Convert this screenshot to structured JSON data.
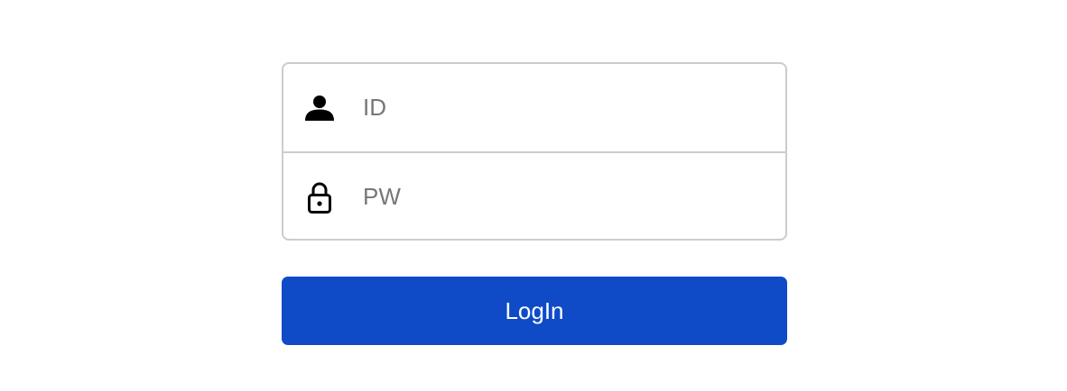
{
  "login_form": {
    "id_field": {
      "icon": "user-icon",
      "placeholder": "ID",
      "value": ""
    },
    "pw_field": {
      "icon": "lock-icon",
      "placeholder": "PW",
      "value": ""
    },
    "submit_label": "LogIn"
  },
  "colors": {
    "button_background": "#0f4bc7",
    "button_text": "#ffffff",
    "border": "#cccccc",
    "placeholder": "#777777"
  }
}
